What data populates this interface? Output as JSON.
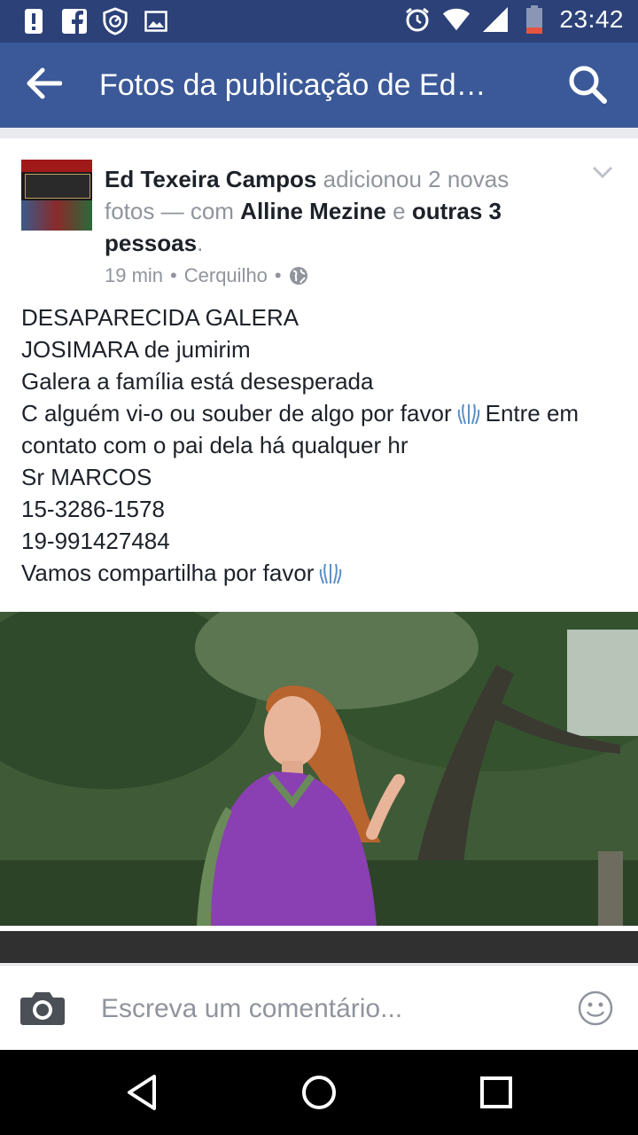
{
  "status_bar": {
    "time": "23:42",
    "left_icons": [
      "alert-icon",
      "facebook-icon",
      "shield-icon",
      "image-icon"
    ],
    "right_icons": [
      "alarm-icon",
      "wifi-icon",
      "signal-icon",
      "battery-icon"
    ]
  },
  "app_bar": {
    "title": "Fotos da publicação de Ed…",
    "back_icon": "back-arrow-icon",
    "search_icon": "search-icon"
  },
  "post": {
    "author": "Ed Texeira Campos",
    "action": "adicionou 2 novas fotos — com",
    "tagged_user": "Alline Mezine",
    "conjunction": "e",
    "others": "outras 3 pessoas",
    "period": ".",
    "time": "19 min",
    "location": "Cerquilho",
    "separator": "•",
    "audience_icon": "globe-icon",
    "lines": {
      "l1": "DESAPARECIDA GALERA",
      "l2": "JOSIMARA  de jumirim",
      "l3": "Galera a família está desesperada",
      "l4a": "C alguém vi-o ou souber de algo por favor",
      "l4b": "Entre em contato com o pai dela há qualquer hr",
      "l5": "Sr MARCOS",
      "l6": "15-3286-1578",
      "l7": "19-991427484",
      "l8": "Vamos compartilha por favor"
    }
  },
  "comment_bar": {
    "placeholder": "Escreva um comentário..."
  },
  "nav": {
    "back": "back-triangle-icon",
    "home": "home-circle-icon",
    "recents": "recents-square-icon"
  }
}
